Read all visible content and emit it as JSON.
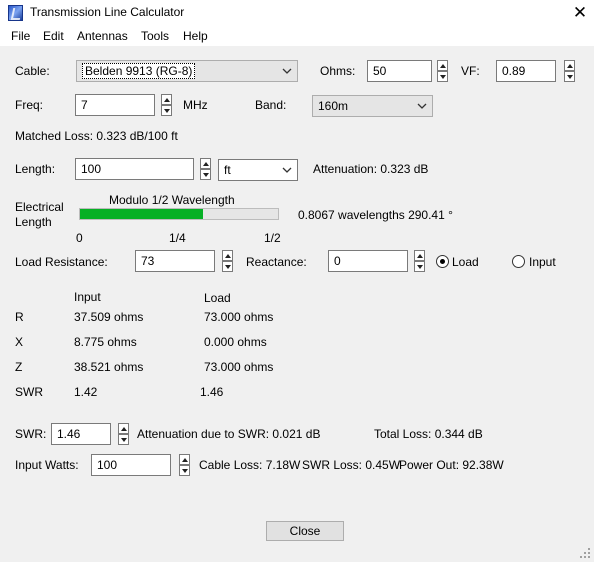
{
  "window": {
    "title": "Transmission Line Calculator",
    "close_glyph": "✕"
  },
  "menu": [
    "File",
    "Edit",
    "Antennas",
    "Tools",
    "Help"
  ],
  "cable": {
    "label": "Cable:",
    "value": "Belden 9913 (RG-8)"
  },
  "ohms": {
    "label": "Ohms:",
    "value": "50"
  },
  "vf": {
    "label": "VF:",
    "value": "0.89"
  },
  "freq": {
    "label": "Freq:",
    "value": "7",
    "unit": "MHz"
  },
  "band": {
    "label": "Band:",
    "value": "160m"
  },
  "matched_loss": "Matched Loss: 0.323 dB/100 ft",
  "length": {
    "label": "Length:",
    "value": "100",
    "unit": "ft",
    "attenuation": "Attenuation: 0.323 dB"
  },
  "electrical_length": {
    "label_line1": "Electrical",
    "label_line2": "Length",
    "bar_title": "Modulo 1/2 Wavelength",
    "fraction": 0.62,
    "ticks": [
      "0",
      "1/4",
      "1/2"
    ],
    "readout": "0.8067 wavelengths  290.41 °"
  },
  "load_resistance": {
    "label": "Load Resistance:",
    "value": "73"
  },
  "reactance": {
    "label": "Reactance:",
    "value": "0"
  },
  "radio": {
    "load": "Load",
    "input": "Input",
    "selected": "load"
  },
  "results": {
    "col_input": "Input",
    "col_load": "Load",
    "rows": [
      {
        "name": "R",
        "input": "37.509 ohms",
        "load": "73.000 ohms"
      },
      {
        "name": "X",
        "input": "8.775 ohms",
        "load": "0.000 ohms"
      },
      {
        "name": "Z",
        "input": "38.521 ohms",
        "load": "73.000 ohms"
      },
      {
        "name": "SWR",
        "input": "1.42",
        "load": "1.46"
      }
    ]
  },
  "swr": {
    "label": "SWR:",
    "value": "1.46",
    "attenuation": "Attenuation due to SWR:  0.021 dB",
    "total_loss": "Total Loss: 0.344 dB"
  },
  "watts": {
    "label": "Input Watts:",
    "value": "100",
    "cable_loss": "Cable Loss: 7.18W",
    "swr_loss": "SWR Loss: 0.45W",
    "power_out": "Power Out: 92.38W"
  },
  "close_button": "Close",
  "icons": {
    "app": "app-icon",
    "close": "close-icon",
    "dropdown": "chevron-down-icon",
    "spinner": "spinner-arrows-icon",
    "grip": "resize-grip-icon"
  },
  "colors": {
    "progress": "#06b025",
    "window_bg": "#f0f0f0"
  }
}
